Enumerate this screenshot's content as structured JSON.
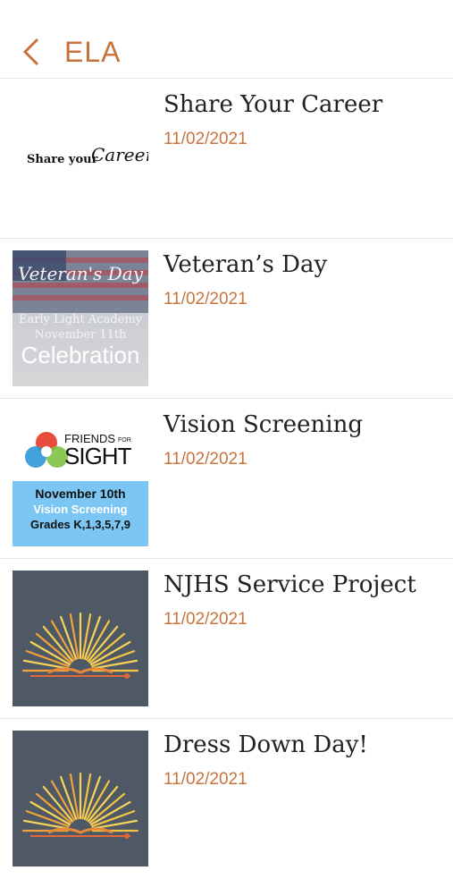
{
  "header": {
    "title": "ELA",
    "accent": "#c8733b"
  },
  "items": [
    {
      "title": "Share Your Career",
      "date": "11/02/2021",
      "thumb": {
        "text_plain": "Share your",
        "text_script": "Career"
      }
    },
    {
      "title": "Veteran’s Day",
      "date": "11/02/2021",
      "thumb": {
        "script": "Veteran's Day",
        "line1": "Early Light Academy",
        "line2": "November 11th",
        "line3": "Celebration"
      }
    },
    {
      "title": "Vision Screening",
      "date": "11/02/2021",
      "thumb": {
        "logo_top": "FRIENDS",
        "logo_for": "FOR",
        "logo_main": "SIGHT",
        "line1": "November 10th",
        "line2": "Vision Screening",
        "line3": "Grades K,1,3,5,7,9"
      }
    },
    {
      "title": "NJHS Service Project",
      "date": "11/02/2021",
      "thumb": {
        "icon": "sunburst-book-icon"
      }
    },
    {
      "title": "Dress Down Day!",
      "date": "11/02/2021",
      "thumb": {
        "icon": "sunburst-book-icon"
      }
    }
  ]
}
